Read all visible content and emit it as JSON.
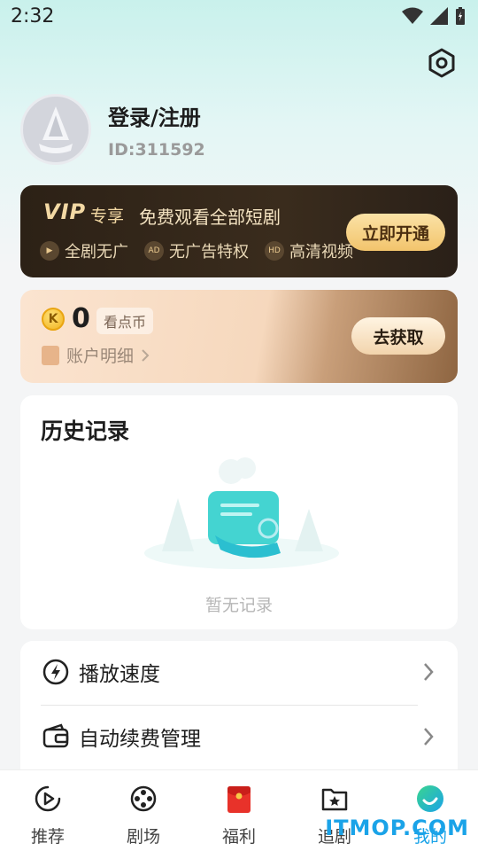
{
  "status_bar": {
    "time": "2:32"
  },
  "profile": {
    "login_label": "登录/注册",
    "user_id": "ID:311592"
  },
  "vip_card": {
    "logo": "VIP",
    "logo_sub": "专享",
    "title": "免费观看全部短剧",
    "features": [
      "全剧无广",
      "无广告特权",
      "高清视频"
    ],
    "button": "立即开通"
  },
  "coin_card": {
    "coin_glyph": "K",
    "count": "0",
    "unit": "看点币",
    "detail_label": "账户明细",
    "button": "去获取"
  },
  "history": {
    "title": "历史记录",
    "empty_text": "暂无记录"
  },
  "menu": {
    "items": [
      {
        "label": "播放速度",
        "icon": "speed-icon"
      },
      {
        "label": "自动续费管理",
        "icon": "wallet-icon"
      }
    ]
  },
  "bottom_nav": {
    "items": [
      {
        "label": "推荐",
        "icon": "play-icon"
      },
      {
        "label": "剧场",
        "icon": "film-reel-icon"
      },
      {
        "label": "福利",
        "icon": "red-envelope-icon"
      },
      {
        "label": "追剧",
        "icon": "star-folder-icon"
      },
      {
        "label": "我的",
        "icon": "profile-icon"
      }
    ],
    "active_index": 4
  },
  "watermark": "ITMOP.COM",
  "colors": {
    "accent": "#1aa3e8",
    "vip_gold": "#f2c46c",
    "vip_bg": "#2c2116"
  }
}
